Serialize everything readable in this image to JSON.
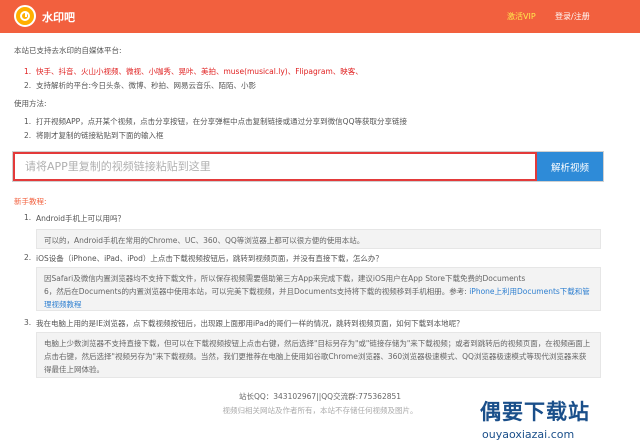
{
  "header": {
    "brand": "水印吧",
    "vip": "激活VIP",
    "login": "登录/注册",
    "colors": {
      "bar": "#f2603e",
      "logo": "#ffb000",
      "vip": "#ffe94d"
    }
  },
  "intro": {
    "supported_title": "本站已支持去水印的自媒体平台:",
    "platforms": [
      {
        "num": "1.",
        "text": "快手、抖音、火山小视频、微视、小咖秀、晃咔、美拍、muse(musical.ly)、Flipagram、映客、"
      },
      {
        "num": "2.",
        "text": "支持解析的平台:今日头条、微博、秒拍、网易云音乐、陌陌、小影"
      }
    ],
    "usage_title": "使用方法:",
    "usage": [
      {
        "num": "1.",
        "text": "打开视频APP，点开某个视频，点击分享按钮，在分享弹框中点击复制链接或通过分享到微信QQ等获取分享链接"
      },
      {
        "num": "2.",
        "text": "将刚才复制的链接粘贴到下面的输入框"
      }
    ]
  },
  "search": {
    "placeholder": "请将APP里复制的视频链接粘贴到这里",
    "button": "解析视频",
    "colors": {
      "button": "#2e8bd8",
      "highlight": "#e33a3a"
    }
  },
  "faq": {
    "title": "新手教程:",
    "items": [
      {
        "num": "1.",
        "q": "Android手机上可以用吗？",
        "a": "可以的，Android手机在常用的Chrome、UC、360、QQ等浏览器上都可以很方便的使用本站。"
      },
      {
        "num": "2.",
        "q": "iOS设备（iPhone、iPad、iPod）上点击下载视频按钮后，跳转到视频页面，并没有直接下载，怎么办？",
        "a_line1": "因Safari及微信内置浏览器均不支持下载文件，所以保存视频需要借助第三方App来完成下载，建议iOS用户在App Store下载免费的Documents",
        "a_line2": "6，然后在Documents的内置浏览器中使用本站，可以完美下载视频，并且Documents支持将下载的视频移到手机相册。参考:",
        "a_link": "iPhone上利用Documents下载和管理视频教程"
      },
      {
        "num": "3.",
        "q": "我在电脑上用的是IE浏览器，点下载视频按钮后，出现跟上面那用iPad的哥们一样的情况，跳转到视频页面，如何下载到本地呢？",
        "a": "电脑上少数浏览器不支持直接下载，但可以在下载视频按钮上点击右键，然后选择\"目标另存为\"或\"链接存储为\"来下载视频；或者到跳转后的视频页面，在视频画面上点击右键，然后选择\"视频另存为\"来下载视频。当然，我们更推荐在电脑上使用如谷歌Chrome浏览器、360浏览器极速模式、QQ浏览器极速模式等现代浏览器来获得最佳上网体验。"
      }
    ]
  },
  "footer": {
    "contact": "站长QQ：343102967||QQ交流群:775362851",
    "notice": "视频归相关网站及作者所有，本站不存储任何视频及图片。"
  },
  "watermark": {
    "big": "偶要下载站",
    "small": "ouyaoxiazai.com",
    "color": "#1a4f8a"
  }
}
